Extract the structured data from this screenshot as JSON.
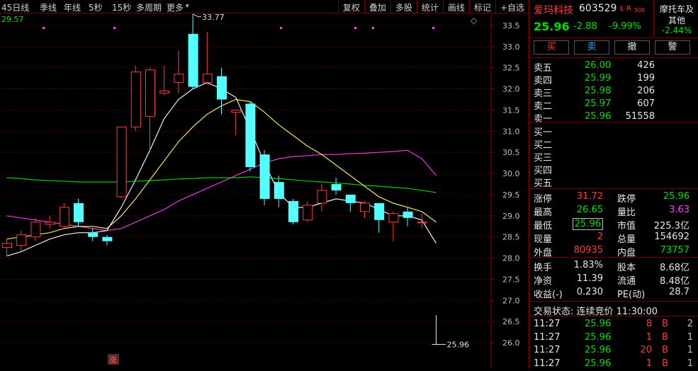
{
  "toolbar": {
    "left": [
      "45日线",
      "季线",
      "年线",
      "5秒",
      "15秒",
      "多周期",
      "更多"
    ],
    "more_arrow": "▾",
    "right": [
      "复权",
      "叠加",
      "多股",
      "统计",
      "画线",
      "标记",
      "+自选"
    ]
  },
  "chart": {
    "corner_value": "29.57",
    "high_label": "33.77",
    "last_label": "25.96",
    "zhang_badge": "涨",
    "diamond": "◇",
    "y_ticks": [
      "33.5",
      "33.0",
      "32.5",
      "32.0",
      "31.5",
      "31.0",
      "30.5",
      "30.0",
      "29.5",
      "29.0",
      "28.5",
      "28.0",
      "27.5",
      "27.0",
      "26.5",
      "26.0"
    ],
    "ylim": [
      25.8,
      33.75
    ],
    "candles": [
      {
        "o": 28.25,
        "c": 28.35,
        "h": 28.45,
        "l": 28.05
      },
      {
        "o": 28.3,
        "c": 28.55,
        "h": 28.65,
        "l": 28.15
      },
      {
        "o": 28.5,
        "c": 28.85,
        "h": 28.95,
        "l": 28.4
      },
      {
        "o": 28.8,
        "c": 28.85,
        "h": 29.0,
        "l": 28.7
      },
      {
        "o": 28.75,
        "c": 29.2,
        "h": 29.3,
        "l": 28.7
      },
      {
        "o": 29.3,
        "c": 28.85,
        "h": 29.4,
        "l": 28.75
      },
      {
        "o": 28.6,
        "c": 28.5,
        "h": 28.7,
        "l": 28.4
      },
      {
        "o": 28.5,
        "c": 28.4,
        "h": 28.55,
        "l": 28.3
      },
      {
        "o": 29.45,
        "c": 31.1,
        "h": 31.1,
        "l": 29.4
      },
      {
        "o": 31.1,
        "c": 32.4,
        "h": 32.55,
        "l": 31.0
      },
      {
        "o": 31.35,
        "c": 32.45,
        "h": 32.5,
        "l": 30.5
      },
      {
        "o": 31.9,
        "c": 31.95,
        "h": 32.55,
        "l": 31.85
      },
      {
        "o": 32.15,
        "c": 32.35,
        "h": 32.9,
        "l": 31.9
      },
      {
        "o": 33.3,
        "c": 32.05,
        "h": 33.77,
        "l": 32.0
      },
      {
        "o": 32.15,
        "c": 32.35,
        "h": 33.35,
        "l": 32.1
      },
      {
        "o": 32.3,
        "c": 31.75,
        "h": 32.5,
        "l": 31.4
      },
      {
        "o": 31.45,
        "c": 31.5,
        "h": 31.5,
        "l": 30.9
      },
      {
        "o": 31.65,
        "c": 30.15,
        "h": 31.7,
        "l": 30.05
      },
      {
        "o": 30.45,
        "c": 29.4,
        "h": 30.55,
        "l": 29.25
      },
      {
        "o": 29.8,
        "c": 29.4,
        "h": 29.95,
        "l": 29.2
      },
      {
        "o": 29.35,
        "c": 28.85,
        "h": 29.4,
        "l": 28.8
      },
      {
        "o": 28.9,
        "c": 29.25,
        "h": 29.35,
        "l": 28.85
      },
      {
        "o": 29.3,
        "c": 29.6,
        "h": 29.75,
        "l": 29.1
      },
      {
        "o": 29.75,
        "c": 29.6,
        "h": 29.9,
        "l": 29.5
      },
      {
        "o": 29.5,
        "c": 29.3,
        "h": 29.5,
        "l": 29.1
      },
      {
        "o": 29.1,
        "c": 29.3,
        "h": 29.35,
        "l": 28.95
      },
      {
        "o": 29.3,
        "c": 28.9,
        "h": 29.3,
        "l": 28.6
      },
      {
        "o": 28.85,
        "c": 29.05,
        "h": 29.1,
        "l": 28.4
      },
      {
        "o": 29.1,
        "c": 28.95,
        "h": 29.2,
        "l": 28.75
      },
      {
        "o": 28.85,
        "c": 28.85,
        "h": 29.05,
        "l": 28.7
      },
      {
        "o": 26.65,
        "c": 25.96,
        "h": 26.65,
        "l": 25.96
      }
    ],
    "ma_white": [
      28.05,
      28.15,
      28.3,
      28.45,
      28.55,
      28.6,
      28.6,
      28.65,
      29.2,
      29.85,
      30.55,
      31.3,
      31.75,
      32.0,
      32.15,
      32.0,
      31.8,
      31.05,
      30.25,
      29.55,
      29.2,
      29.2,
      29.3,
      29.4,
      29.35,
      29.3,
      29.15,
      29.0,
      29.0,
      28.9,
      28.35
    ],
    "ma_yellow": [
      28.45,
      28.5,
      28.55,
      28.6,
      28.7,
      28.75,
      28.75,
      28.7,
      29.0,
      29.4,
      29.85,
      30.3,
      30.75,
      31.1,
      31.4,
      31.6,
      31.75,
      31.7,
      31.45,
      31.15,
      30.9,
      30.65,
      30.45,
      30.2,
      29.95,
      29.7,
      29.45,
      29.3,
      29.2,
      29.1,
      28.85
    ],
    "ma_magenta": [
      29.0,
      28.95,
      28.9,
      28.85,
      28.8,
      28.75,
      28.7,
      28.65,
      28.7,
      28.85,
      29.0,
      29.15,
      29.35,
      29.5,
      29.65,
      29.8,
      29.95,
      30.1,
      30.25,
      30.35,
      30.4,
      30.42,
      30.45,
      30.45,
      30.47,
      30.48,
      30.5,
      30.52,
      30.55,
      30.35,
      29.95
    ],
    "ma_green": [
      29.9,
      29.88,
      29.85,
      29.83,
      29.82,
      29.8,
      29.8,
      29.8,
      29.8,
      29.82,
      29.83,
      29.85,
      29.87,
      29.88,
      29.9,
      29.9,
      29.9,
      29.92,
      29.9,
      29.88,
      29.85,
      29.82,
      29.8,
      29.78,
      29.75,
      29.72,
      29.7,
      29.67,
      29.65,
      29.6,
      29.55
    ]
  },
  "stock": {
    "name": "爱玛科技",
    "code": "603529",
    "flags": "L R",
    "flag_sub": "500",
    "price": "25.96",
    "change": "-2.88",
    "change_pct": "-9.99%",
    "sector_line1": "摩托车及",
    "sector_line2": "其他",
    "sector_pct": "-2.44%"
  },
  "buttons": [
    {
      "label": "买",
      "color": "#ff3b3b"
    },
    {
      "label": "卖",
      "color": "#3aa0ff"
    },
    {
      "label": "撤",
      "color": "#e0e0e0"
    },
    {
      "label": "警",
      "color": "#e0e0e0"
    }
  ],
  "asks": [
    {
      "label": "卖五",
      "price": "26.00",
      "vol": "426"
    },
    {
      "label": "卖四",
      "price": "25.99",
      "vol": "199"
    },
    {
      "label": "卖三",
      "price": "25.98",
      "vol": "206"
    },
    {
      "label": "卖二",
      "price": "25.97",
      "vol": "607"
    },
    {
      "label": "卖一",
      "price": "25.96",
      "vol": "51558"
    }
  ],
  "bids": [
    "买一",
    "买二",
    "买三",
    "买四",
    "买五"
  ],
  "stats": [
    {
      "l1": "涨停",
      "v1": "31.72",
      "c1": "#ff3b3b",
      "l2": "跌停",
      "v2": "25.96",
      "c2": "#00e000"
    },
    {
      "l1": "最高",
      "v1": "26.65",
      "c1": "#00e000",
      "l2": "量比",
      "v2": "3.63",
      "c2": "#ff40ff"
    },
    {
      "l1": "最低",
      "v1": "25.96",
      "c1": "#00e000",
      "l2": "市值",
      "v2": "225.3亿",
      "c2": "#e6e6e6"
    },
    {
      "l1": "现量",
      "v1": "2",
      "c1": "#ff3b3b",
      "l2": "总量",
      "v2": "154692",
      "c2": "#e6e6e6"
    },
    {
      "l1": "外盘",
      "v1": "80935",
      "c1": "#ff3b3b",
      "l2": "内盘",
      "v2": "73757",
      "c2": "#00e000"
    }
  ],
  "fin": [
    {
      "l1": "换手",
      "v1": "1.83%",
      "l2": "股本",
      "v2": "8.68亿"
    },
    {
      "l1": "净资",
      "v1": "11.39",
      "l2": "流通",
      "v2": "8.48亿"
    },
    {
      "l1": "收益(-)",
      "v1": "0.230",
      "l2": "PE(动)",
      "v2": "28.7"
    }
  ],
  "trade_status": "交易状态: 连续竞价 11:30:00",
  "ticks": [
    {
      "t": "11:27",
      "p": "25.96",
      "v": "8",
      "s": "B",
      "n": "2"
    },
    {
      "t": "11:27",
      "p": "25.96",
      "v": "1",
      "s": "B",
      "n": "1"
    },
    {
      "t": "11:27",
      "p": "25.96",
      "v": "20",
      "s": "B",
      "n": "1"
    },
    {
      "t": "11:27",
      "p": "25.96",
      "v": "1",
      "s": "B",
      "n": "1"
    }
  ]
}
